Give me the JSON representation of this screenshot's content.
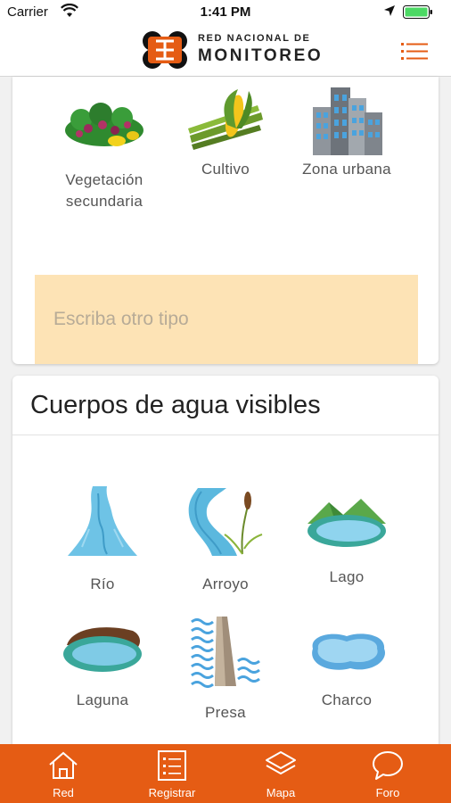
{
  "status_bar": {
    "carrier": "Carrier",
    "time": "1:41 PM"
  },
  "header": {
    "logo_line1": "RED NACIONAL DE",
    "logo_line2": "MONITOREO",
    "menu_icon": "list-icon",
    "accent_color": "#e55c14"
  },
  "land_use": {
    "options": [
      {
        "label_line1": "Vegetación",
        "label_line2": "secundaria",
        "icon": "secondary-vegetation-icon"
      },
      {
        "label_line1": "Cultivo",
        "label_line2": "",
        "icon": "corn-crop-icon"
      },
      {
        "label_line1": "Zona urbana",
        "label_line2": "",
        "icon": "city-buildings-icon"
      }
    ],
    "other_placeholder": "Escriba otro tipo"
  },
  "water_bodies": {
    "title": "Cuerpos de agua visibles",
    "options": [
      {
        "label": "Río",
        "icon": "river-icon"
      },
      {
        "label": "Arroyo",
        "icon": "stream-icon"
      },
      {
        "label": "Lago",
        "icon": "lake-icon"
      },
      {
        "label": "Laguna",
        "icon": "lagoon-icon"
      },
      {
        "label": "Presa",
        "icon": "dam-icon"
      },
      {
        "label": "Charco",
        "icon": "puddle-icon"
      }
    ]
  },
  "tab_bar": {
    "tabs": [
      {
        "label": "Red",
        "icon": "home-icon"
      },
      {
        "label": "Registrar",
        "icon": "register-list-icon"
      },
      {
        "label": "Mapa",
        "icon": "map-layers-icon"
      },
      {
        "label": "Foro",
        "icon": "chat-bubble-icon"
      }
    ]
  }
}
